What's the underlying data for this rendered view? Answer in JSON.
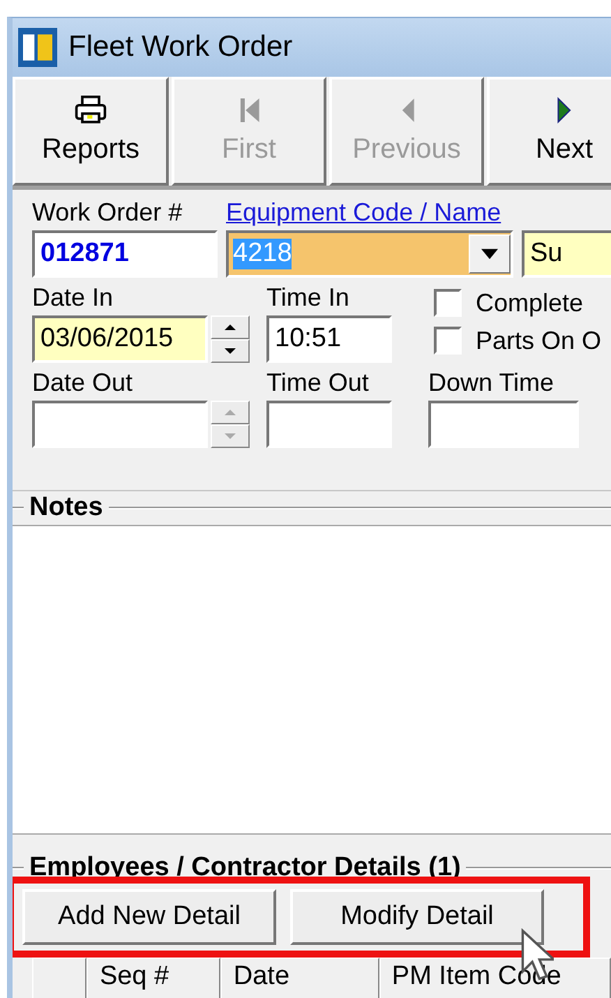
{
  "window": {
    "title": "Fleet Work Order"
  },
  "toolbar": [
    {
      "label": "Reports",
      "kind": "printer",
      "disabled": false
    },
    {
      "label": "First",
      "kind": "first",
      "disabled": true
    },
    {
      "label": "Previous",
      "kind": "previous",
      "disabled": true
    },
    {
      "label": "Next",
      "kind": "next",
      "disabled": false
    }
  ],
  "form": {
    "work_order": {
      "label": "Work Order #",
      "value": "012871"
    },
    "equipment": {
      "label": "Equipment Code / Name",
      "value": "4218",
      "text_selected": true,
      "name_value": "Su"
    },
    "date_in": {
      "label": "Date In",
      "value": "03/06/2015"
    },
    "time_in": {
      "label": "Time In",
      "value": "10:51"
    },
    "checkboxes": [
      {
        "label": "Complete",
        "checked": false
      },
      {
        "label": "Parts On O",
        "checked": false
      }
    ],
    "date_out": {
      "label": "Date Out"
    },
    "time_out": {
      "label": "Time Out"
    },
    "down_time": {
      "label": "Down Time"
    }
  },
  "notes": {
    "title": "Notes"
  },
  "details": {
    "title": "Employees / Contractor Details (1)",
    "buttons": [
      "Add New Detail",
      "Modify Detail"
    ],
    "columns": [
      "Seq #",
      "Date",
      "PM Item Code"
    ]
  }
}
